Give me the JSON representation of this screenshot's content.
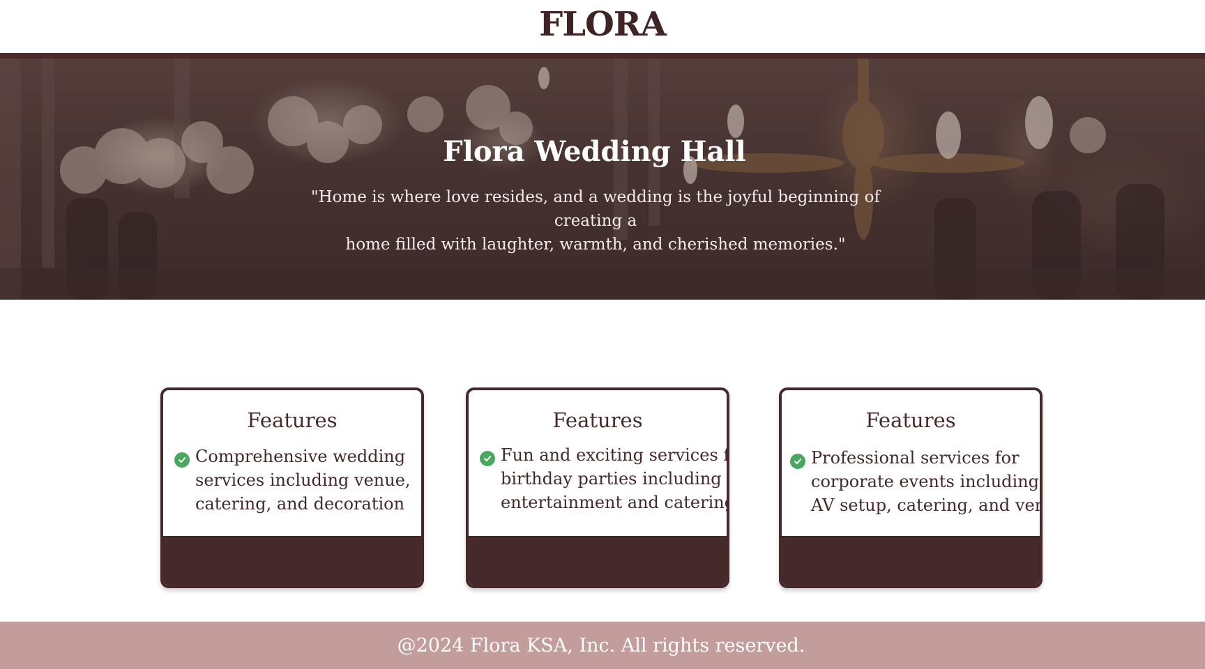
{
  "header": {
    "logo": "FLORA"
  },
  "hero": {
    "title": "Flora Wedding Hall",
    "quote_line1": "\"Home is where love resides, and a wedding is the joyful beginning of creating a",
    "quote_line2": "home filled with laughter, warmth, and cherished memories.\""
  },
  "cards": [
    {
      "title": "Features",
      "icon": "check-circle-icon",
      "lines": [
        "Comprehensive wedding",
        "services including venue,",
        "catering, and decoration"
      ]
    },
    {
      "title": "Features",
      "icon": "check-circle-icon",
      "lines": [
        "Fun and exciting services for",
        "birthday parties including",
        "entertainment and catering"
      ]
    },
    {
      "title": "Features",
      "icon": "check-circle-icon",
      "lines": [
        "Professional services for",
        "corporate events including",
        "AV setup, catering, and venue"
      ]
    }
  ],
  "footer": {
    "text": "@2024 Flora KSA, Inc. All rights reserved."
  },
  "colors": {
    "brand": "#45292b",
    "footer_bg": "#c39c9c",
    "check": "#48a860"
  }
}
